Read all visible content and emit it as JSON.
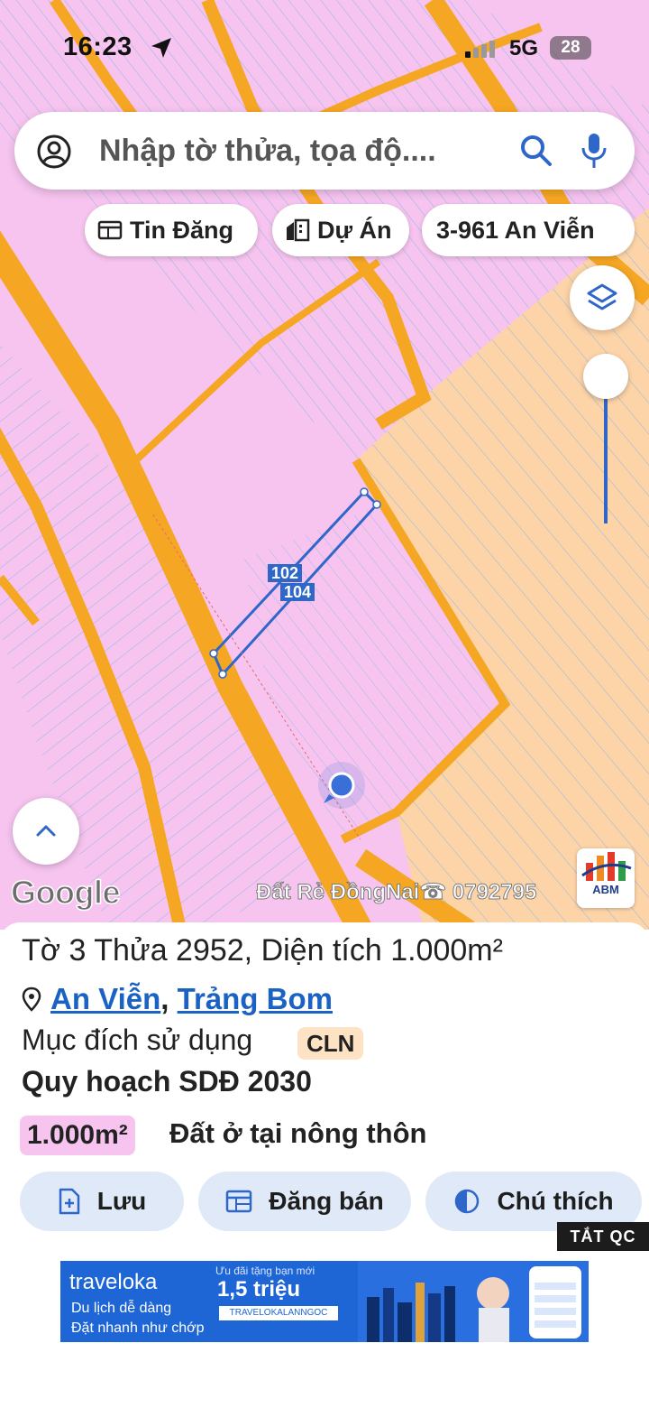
{
  "status_bar": {
    "time": "16:23",
    "network": "5G",
    "battery": "28"
  },
  "search": {
    "placeholder": "Nhập tờ thửa, tọa độ...."
  },
  "chips": [
    {
      "label": "Tin Đăng",
      "icon": "news-icon"
    },
    {
      "label": "Dự Án",
      "icon": "building-icon"
    },
    {
      "label": "3-961 An Viễn",
      "icon": ""
    }
  ],
  "map": {
    "plot_labels": [
      "102",
      "104"
    ],
    "attribution": "Google",
    "watermark": "Đất Rẻ ĐồngNai☎ 0792795",
    "logo_text": "ABM",
    "colors": {
      "residential": "#f6c4ef",
      "perennial": "#fdd4a8",
      "road": "#f5a623",
      "selected": "#2f67c9"
    }
  },
  "parcel": {
    "title": "Tờ 3 Thửa 2952, Diện tích 1.000m²",
    "ward": "An Viễn",
    "separator": ",",
    "district": "Trảng Bom",
    "purpose_label": "Mục đích sử dụng",
    "purpose_code": "CLN",
    "plan_title": "Quy hoạch SDĐ 2030",
    "plan_area": "1.000m²",
    "plan_desc": "Đất ở tại nông thôn"
  },
  "actions": {
    "save": "Lưu",
    "post": "Đăng bán",
    "legend": "Chú thích"
  },
  "ads": {
    "toggle": "TẮT QC",
    "brand": "traveloka",
    "tagline1": "Du lịch dễ dàng",
    "tagline2": "Đặt nhanh như chớp",
    "offer": "Ưu đãi tặng bạn mới",
    "amount": "1,5 triệu",
    "code": "TRAVELOKALANNGOC"
  }
}
